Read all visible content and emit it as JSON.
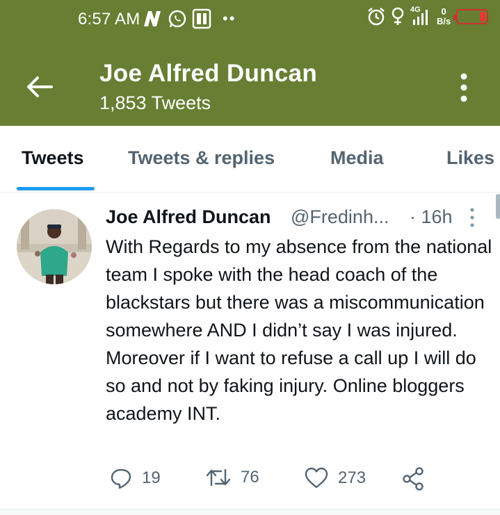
{
  "status_bar": {
    "time": "6:57 AM",
    "network": "4G",
    "speed_value": "0",
    "speed_unit": "B/s",
    "battery_level": 0.2
  },
  "header": {
    "title": "Joe Alfred Duncan",
    "subtitle": "1,853 Tweets"
  },
  "tabs": [
    {
      "label": "Tweets"
    },
    {
      "label": "Tweets & replies"
    },
    {
      "label": "Media"
    },
    {
      "label": "Likes"
    }
  ],
  "tweet": {
    "author": "Joe Alfred Duncan",
    "handle": "@Fredinh...",
    "time": "· 16h",
    "text": "With Regards to my absence from the national team I spoke with the head coach of the blackstars but there was a miscommunication somewhere AND I didn’t say I was injured. Moreover if I want to refuse a call up I will do so and not by faking injury. Online bloggers academy INT.",
    "replies": "19",
    "retweets": "76",
    "likes": "273"
  },
  "colors": {
    "header_bg": "#677e33",
    "accent": "#1d9bf0",
    "muted": "#536471",
    "battery": "#e53935"
  }
}
